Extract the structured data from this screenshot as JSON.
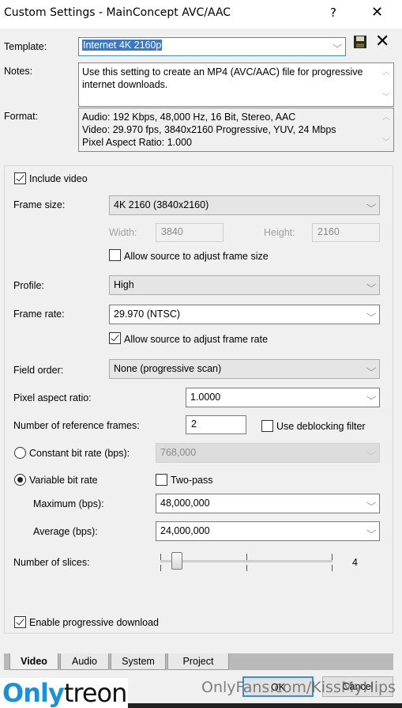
{
  "window": {
    "title": "Custom Settings - MainConcept AVC/AAC",
    "help_label": "?",
    "close_label": "✕"
  },
  "template": {
    "label": "Template:",
    "value": "Internet 4K 2160p",
    "save_icon": "floppy-disk-icon",
    "delete_icon": "delete-x-icon"
  },
  "notes": {
    "label": "Notes:",
    "value": "Use this setting to create an MP4 (AVC/AAC) file for progressive internet downloads."
  },
  "format": {
    "label": "Format:",
    "lines": [
      "Audio: 192 Kbps, 48,000 Hz, 16 Bit, Stereo, AAC",
      "Video: 29.970 fps, 3840x2160 Progressive, YUV, 24 Mbps",
      "Pixel Aspect Ratio: 1.000"
    ]
  },
  "video": {
    "include_video": {
      "label": "Include video",
      "checked": true
    },
    "frame_size": {
      "label": "Frame size:",
      "value": "4K 2160 (3840x2160)"
    },
    "width": {
      "label": "Width:",
      "value": "3840"
    },
    "height": {
      "label": "Height:",
      "value": "2160"
    },
    "allow_frame_size": {
      "label": "Allow source to adjust frame size",
      "checked": false
    },
    "profile": {
      "label": "Profile:",
      "value": "High"
    },
    "frame_rate": {
      "label": "Frame rate:",
      "value": "29.970 (NTSC)"
    },
    "allow_frame_rate": {
      "label": "Allow source to adjust frame rate",
      "checked": true
    },
    "field_order": {
      "label": "Field order:",
      "value": "None (progressive scan)"
    },
    "pixel_aspect": {
      "label": "Pixel aspect ratio:",
      "value": "1.0000"
    },
    "ref_frames": {
      "label": "Number of reference frames:",
      "value": "2"
    },
    "deblocking": {
      "label": "Use deblocking filter",
      "checked": false
    },
    "cbr": {
      "label": "Constant bit rate (bps):",
      "value": "768,000",
      "selected": false
    },
    "vbr": {
      "label": "Variable bit rate",
      "selected": true
    },
    "two_pass": {
      "label": "Two-pass",
      "checked": false
    },
    "maximum": {
      "label": "Maximum (bps):",
      "value": "48,000,000"
    },
    "average": {
      "label": "Average (bps):",
      "value": "24,000,000"
    },
    "slices": {
      "label": "Number of slices:",
      "value": "4",
      "slider_fraction": 0.05
    },
    "progressive_download": {
      "label": "Enable progressive download",
      "checked": true
    }
  },
  "tabs": [
    {
      "label": "Video",
      "active": true
    },
    {
      "label": "Audio",
      "active": false
    },
    {
      "label": "System",
      "active": false
    },
    {
      "label": "Project",
      "active": false
    }
  ],
  "buttons": {
    "ok": "OK",
    "cancel": "Cancel"
  },
  "watermark": {
    "logo_only": "Only",
    "logo_treon": "treon",
    "text": "OnlyFans.com/KissMyHips"
  }
}
